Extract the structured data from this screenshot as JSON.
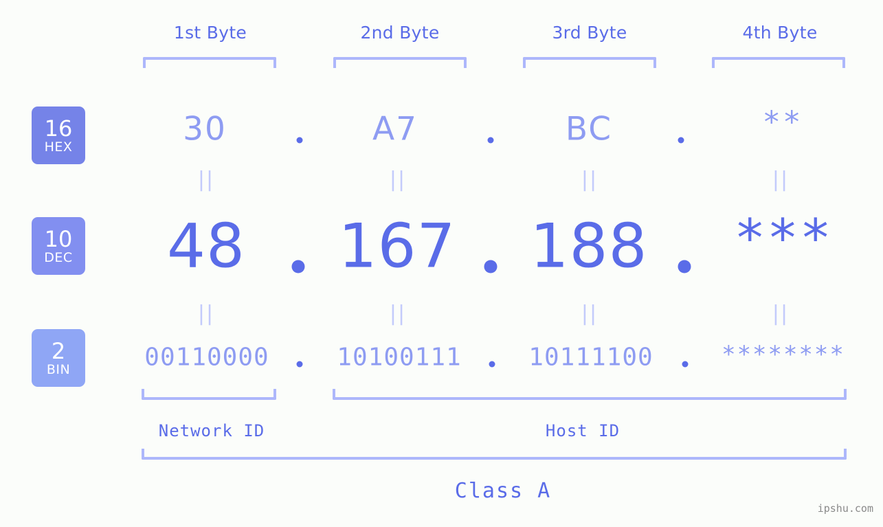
{
  "background_color": "#fbfdfa",
  "accent_strong": "#5a6ce8",
  "accent_mid": "#8e9cf2",
  "accent_light": "#adb7fb",
  "byte_headers": [
    {
      "label": "1st Byte"
    },
    {
      "label": "2nd Byte"
    },
    {
      "label": "3rd Byte"
    },
    {
      "label": "4th Byte"
    }
  ],
  "bases": [
    {
      "number": "16",
      "name": "HEX",
      "color": "#7583e8"
    },
    {
      "number": "10",
      "name": "DEC",
      "color": "#828ff0"
    },
    {
      "number": "2",
      "name": "BIN",
      "color": "#8fa6f5"
    }
  ],
  "rows": {
    "hex": {
      "base_number": "16",
      "base_name": "HEX",
      "values": [
        "30",
        "A7",
        "BC",
        "**"
      ],
      "separator": "."
    },
    "dec": {
      "base_number": "10",
      "base_name": "DEC",
      "values": [
        "48",
        "167",
        "188",
        "***"
      ],
      "separator": "."
    },
    "bin": {
      "base_number": "2",
      "base_name": "BIN",
      "values": [
        "00110000",
        "10100111",
        "10111100",
        "********"
      ],
      "separator": "."
    }
  },
  "equals_symbol": "||",
  "segments": {
    "network_id": "Network ID",
    "host_id": "Host ID"
  },
  "class_label": "Class A",
  "watermark": "ipshu.com"
}
